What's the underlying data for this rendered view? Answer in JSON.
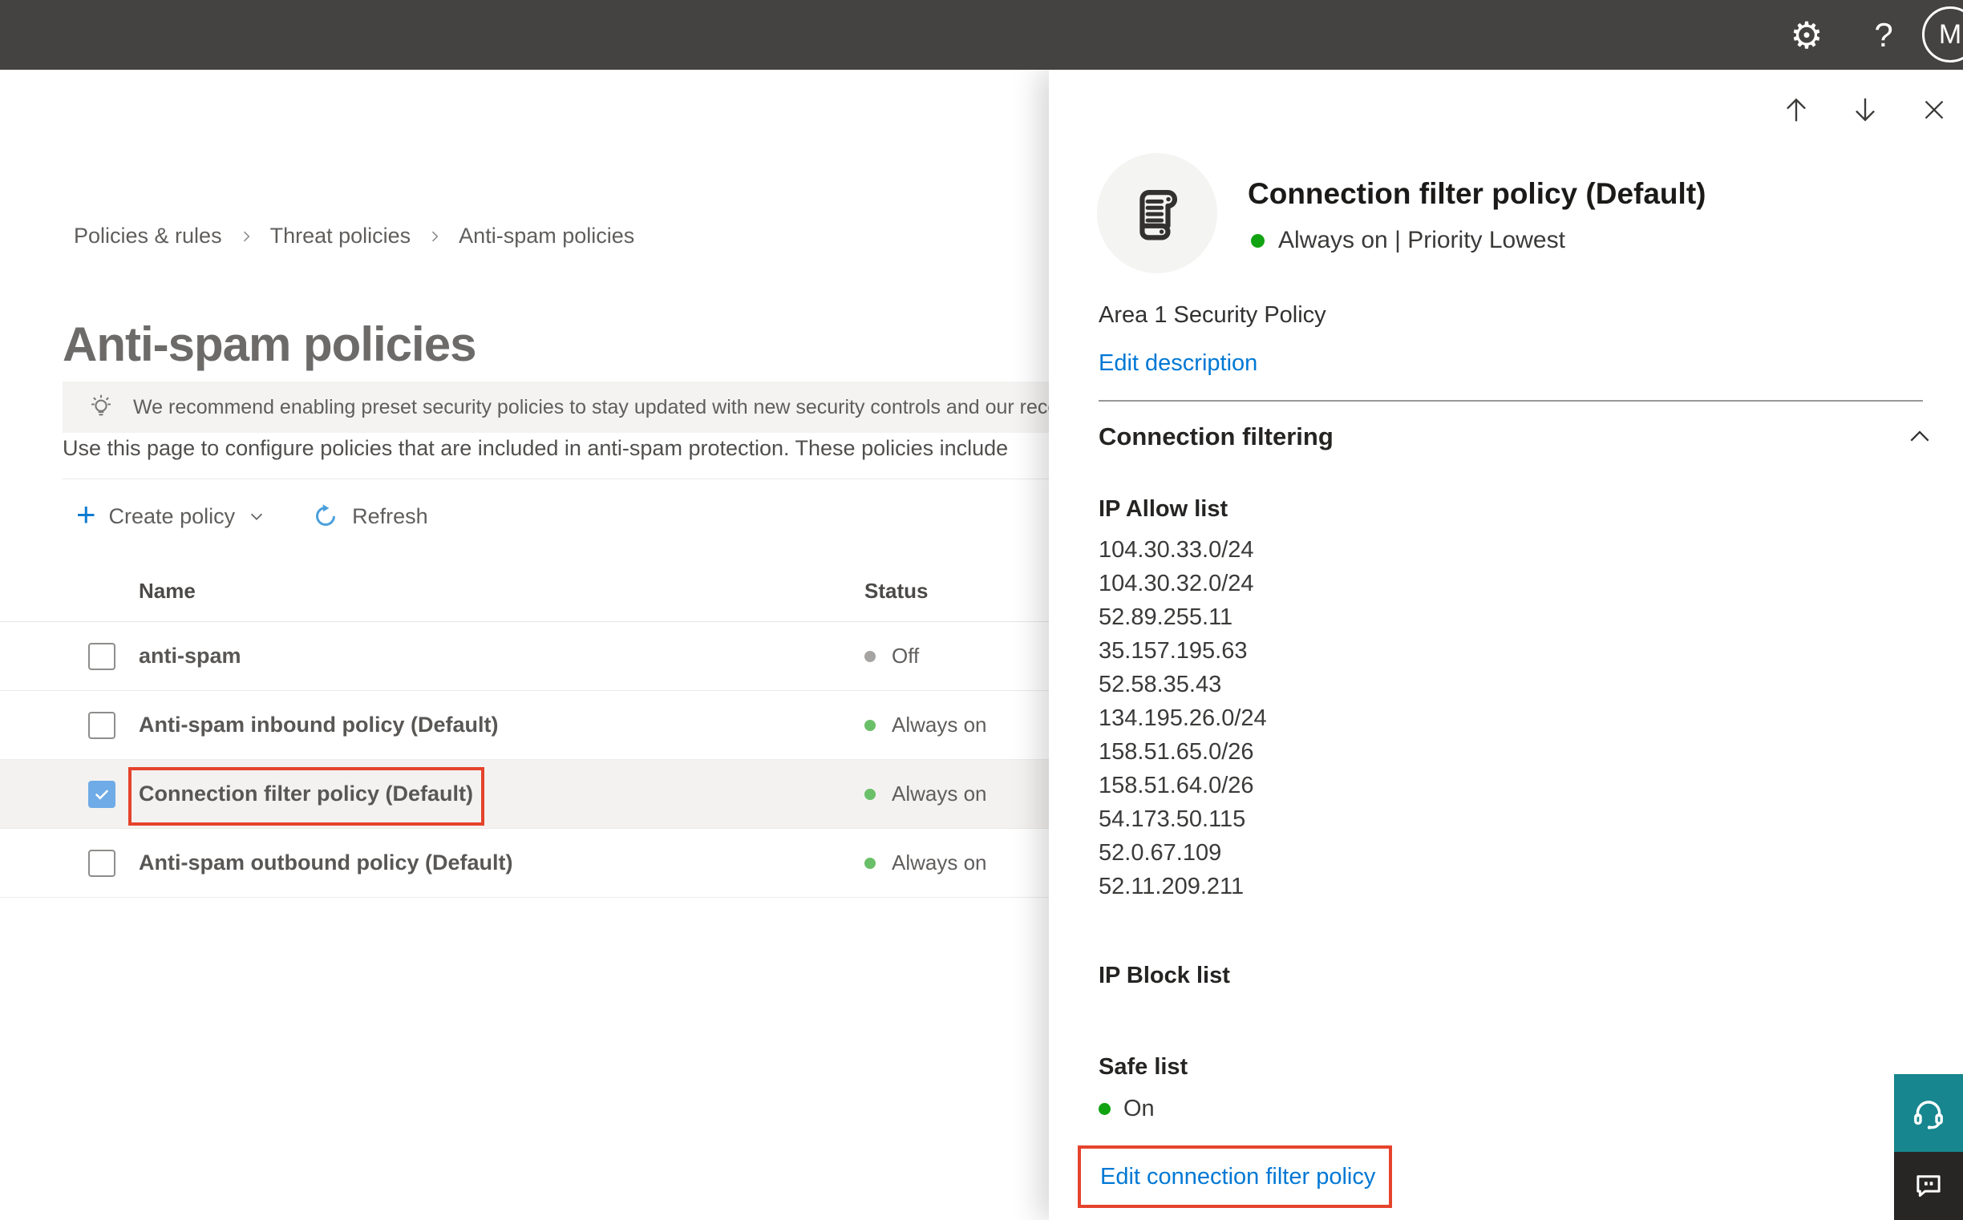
{
  "topbar": {
    "help_label": "?",
    "avatar_initial": "M"
  },
  "breadcrumb": {
    "items": [
      "Policies & rules",
      "Threat policies",
      "Anti-spam policies"
    ]
  },
  "page": {
    "title": "Anti-spam policies",
    "banner_text": "We recommend enabling preset security policies to stay updated with new security controls and our recomme",
    "description": "Use this page to configure policies that are included in anti-spam protection. These policies include"
  },
  "toolbar": {
    "create_label": "Create policy",
    "refresh_label": "Refresh"
  },
  "table": {
    "columns": [
      "Name",
      "Status"
    ],
    "rows": [
      {
        "name": "anti-spam",
        "status": "Off",
        "status_color": "#a6a4a2",
        "checked": false,
        "selected": false
      },
      {
        "name": "Anti-spam inbound policy (Default)",
        "status": "Always on",
        "status_color": "#6abf69",
        "checked": false,
        "selected": false
      },
      {
        "name": "Connection filter policy (Default)",
        "status": "Always on",
        "status_color": "#6abf69",
        "checked": true,
        "selected": true,
        "annotated": true
      },
      {
        "name": "Anti-spam outbound policy (Default)",
        "status": "Always on",
        "status_color": "#6abf69",
        "checked": false,
        "selected": false
      }
    ]
  },
  "panel": {
    "title": "Connection filter policy (Default)",
    "status_line": "Always on | Priority Lowest",
    "status_color": "#11a311",
    "description": "Area 1 Security Policy",
    "edit_description_label": "Edit description",
    "section_title": "Connection filtering",
    "ip_allow": {
      "title": "IP Allow list",
      "items": [
        "104.30.33.0/24",
        "104.30.32.0/24",
        "52.89.255.11",
        "35.157.195.63",
        "52.58.35.43",
        "134.195.26.0/24",
        "158.51.65.0/26",
        "158.51.64.0/26",
        "54.173.50.115",
        "52.0.67.109",
        "52.11.209.211"
      ]
    },
    "ip_block": {
      "title": "IP Block list"
    },
    "safe_list": {
      "title": "Safe list",
      "status": "On"
    },
    "edit_link_label": "Edit connection filter policy"
  },
  "colors": {
    "accent": "#0078d4",
    "annotation_red": "#e5432c",
    "support_teal": "#17868e",
    "topbar": "#454341"
  }
}
